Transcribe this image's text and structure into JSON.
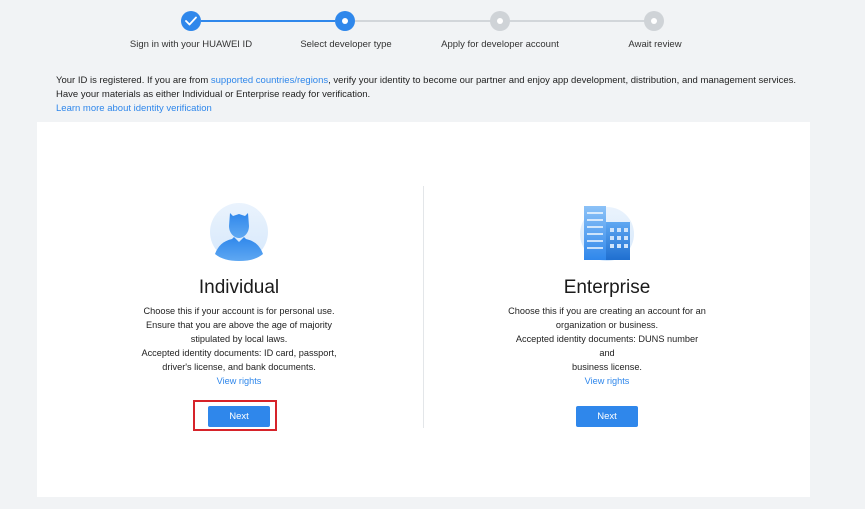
{
  "stepper": {
    "steps": [
      {
        "label": "Sign in with your HUAWEI ID",
        "state": "completed"
      },
      {
        "label": "Select developer type",
        "state": "current"
      },
      {
        "label": "Apply for developer account",
        "state": "pending"
      },
      {
        "label": "Await review",
        "state": "pending"
      }
    ]
  },
  "intro": {
    "line1_prefix": "Your ID is registered. If you are from ",
    "line1_link": "supported countries/regions",
    "line1_suffix": ", verify your identity to become our partner and enjoy app development, distribution, and management services.",
    "line2": "Have your materials as either Individual or Enterprise ready for verification.",
    "learn_more": "Learn more about identity verification"
  },
  "cards": {
    "individual": {
      "title": "Individual",
      "desc_lines": [
        "Choose this if your account is for personal use.",
        "Ensure that you are above the age of majority",
        "stipulated by local laws.",
        "Accepted identity documents: ID card, passport,",
        "driver's license, and bank documents."
      ],
      "view_rights": "View rights",
      "next_label": "Next",
      "icon": "person-icon"
    },
    "enterprise": {
      "title": "Enterprise",
      "desc_lines": [
        "Choose this if you are creating an account for an",
        "organization or business.",
        "Accepted identity documents: DUNS number and",
        "business license."
      ],
      "view_rights": "View rights",
      "next_label": "Next",
      "icon": "building-icon"
    }
  },
  "colors": {
    "accent": "#2f87eb",
    "highlight": "#d6232a",
    "pending_step": "#cfd3d7",
    "background": "#f1f3f5",
    "panel": "#ffffff"
  }
}
